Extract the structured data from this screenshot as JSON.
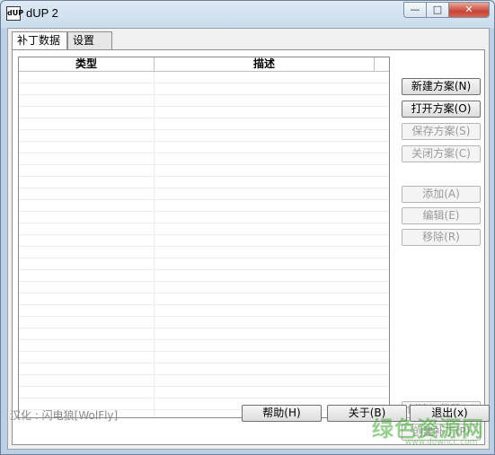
{
  "window": {
    "title": "dUP 2",
    "icon_label": "dUP",
    "min_glyph": "—",
    "max_glyph": "□",
    "close_glyph": "✕"
  },
  "tabs": [
    {
      "label": "补丁数据",
      "active": true
    },
    {
      "label": "设置",
      "active": false
    }
  ],
  "listview": {
    "columns": [
      "类型",
      "描述",
      ""
    ],
    "rows": []
  },
  "buttons": {
    "new_scheme": "新建方案(N)",
    "open_scheme": "打开方案(O)",
    "save_scheme": "保存方案(S)",
    "close_scheme": "关闭方案(C)",
    "add": "添加(A)",
    "edit": "编辑(E)",
    "remove": "移除(R)",
    "create_loader": "创建加载器(L)",
    "create_patch": "创建补丁(P)"
  },
  "footer": {
    "credit": "汉化 : 闪电狼[WolFly]",
    "help": "帮助(H)",
    "about": "关于(B)",
    "exit": "退出(x)"
  },
  "watermark": {
    "text": "绿色资源网",
    "url": "www.downcc.com"
  }
}
